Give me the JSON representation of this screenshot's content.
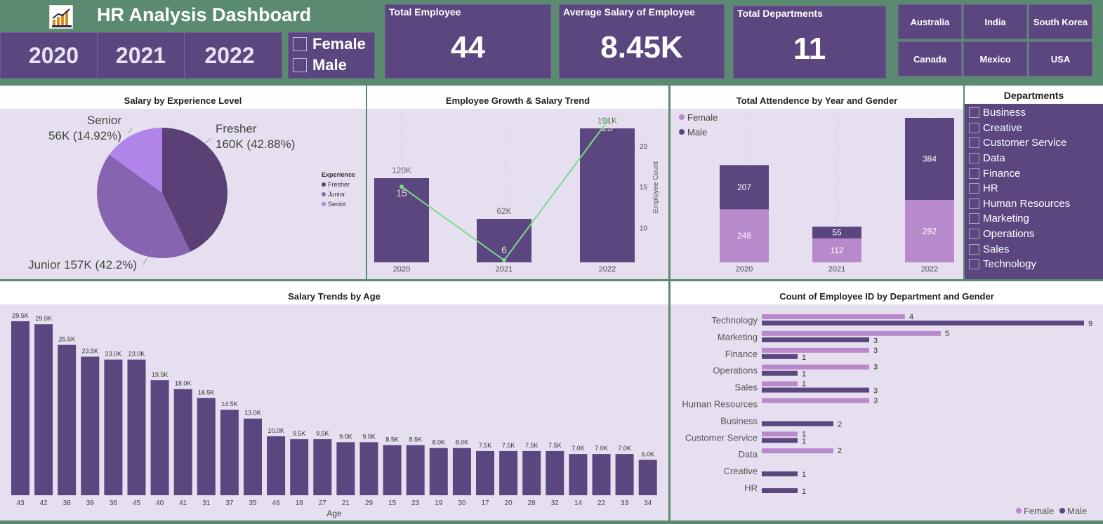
{
  "header": {
    "title": "HR Analysis Dashboard",
    "logo_icon": "company-logo-icon",
    "years": [
      "2020",
      "2021",
      "2022"
    ],
    "genders": [
      "Female",
      "Male"
    ]
  },
  "kpis": {
    "total_employee_label": "Total Employee",
    "total_employee_value": "44",
    "avg_salary_label": "Average Salary of Employee",
    "avg_salary_value": "8.45K",
    "total_departments_label": "Total Departments",
    "total_departments_value": "11"
  },
  "countries": [
    "Australia",
    "India",
    "South Korea",
    "Canada",
    "Mexico",
    "USA"
  ],
  "colors": {
    "header_bg": "#5a8a70",
    "panel": "#5c4680",
    "chart_bg": "#e6dff0",
    "bar_dark": "#5c4680",
    "bar_light": "#b98acb",
    "fresher": "#5a4075",
    "junior": "#8764b0",
    "senior": "#b184ea",
    "line": "#7dd88c"
  },
  "departments_slicer": {
    "title": "Departments",
    "items": [
      "Business",
      "Creative",
      "Customer Service",
      "Data",
      "Finance",
      "HR",
      "Human Resources",
      "Marketing",
      "Operations",
      "Sales",
      "Technology"
    ]
  },
  "charts": {
    "salary_by_experience": {
      "title": "Salary by Experience Level",
      "chart_data": {
        "type": "pie",
        "slices": [
          {
            "name": "Fresher",
            "value": 160,
            "label": "160K (42.88%)",
            "color": "#5a4075"
          },
          {
            "name": "Junior",
            "value": 157,
            "label": "157K (42.2%)",
            "color": "#8764b0"
          },
          {
            "name": "Senior",
            "value": 56,
            "label": "56K (14.92%)",
            "color": "#b184ea"
          }
        ]
      }
    },
    "growth_trend": {
      "title": "Employee Growth & Salary Trend",
      "legend_title": "Experience",
      "legend": [
        "Fresher",
        "Junior",
        "Senior"
      ],
      "y2label": "Employee Count",
      "chart_data": {
        "type": "bar",
        "categories": [
          "2020",
          "2021",
          "2022"
        ],
        "salary_values": [
          120,
          62,
          191
        ],
        "salary_labels": [
          "120K",
          "62K",
          "191K"
        ],
        "employee_count": [
          15,
          6,
          23
        ],
        "y2_ticks": [
          10,
          15,
          20
        ],
        "y2lim": [
          6,
          23
        ]
      }
    },
    "attendance": {
      "title": "Total Attendence by Year and Gender",
      "legend": [
        "Female",
        "Male"
      ],
      "chart_data": {
        "type": "bar",
        "stacked": true,
        "categories": [
          "2020",
          "2021",
          "2022"
        ],
        "series": [
          {
            "name": "Female",
            "values": [
              248,
              112,
              292
            ]
          },
          {
            "name": "Male",
            "values": [
              207,
              55,
              384
            ]
          }
        ]
      }
    },
    "salary_by_age": {
      "title": "Salary Trends by Age",
      "xlabel": "Age",
      "chart_data": {
        "type": "bar",
        "categories": [
          "43",
          "42",
          "38",
          "39",
          "36",
          "45",
          "40",
          "41",
          "31",
          "37",
          "35",
          "46",
          "18",
          "27",
          "21",
          "29",
          "15",
          "23",
          "19",
          "30",
          "17",
          "20",
          "28",
          "32",
          "14",
          "22",
          "33",
          "34"
        ],
        "values": [
          29.5,
          29.0,
          25.5,
          23.5,
          23.0,
          23.0,
          19.5,
          18.0,
          16.5,
          14.5,
          13.0,
          10.0,
          9.5,
          9.5,
          9.0,
          9.0,
          8.5,
          8.5,
          8.0,
          8.0,
          7.5,
          7.5,
          7.5,
          7.5,
          7.0,
          7.0,
          7.0,
          6.0
        ],
        "labels": [
          "29.5K",
          "29.0K",
          "25.5K",
          "23.5K",
          "23.0K",
          "23.0K",
          "19.5K",
          "18.0K",
          "16.5K",
          "14.5K",
          "13.0K",
          "10.0K",
          "9.5K",
          "9.5K",
          "9.0K",
          "9.0K",
          "8.5K",
          "8.5K",
          "8.0K",
          "8.0K",
          "7.5K",
          "7.5K",
          "7.5K",
          "7.5K",
          "7.0K",
          "7.0K",
          "7.0K",
          "6.0K"
        ]
      }
    },
    "dept_gender": {
      "title": "Count of Employee ID by Department and Gender",
      "legend": [
        "Female",
        "Male"
      ],
      "chart_data": {
        "type": "bar",
        "orientation": "horizontal",
        "categories": [
          "Technology",
          "Marketing",
          "Finance",
          "Operations",
          "Sales",
          "Human Resources",
          "Business",
          "Customer Service",
          "Data",
          "Creative",
          "HR"
        ],
        "series": [
          {
            "name": "Female",
            "values": [
              4,
              5,
              3,
              3,
              1,
              3,
              null,
              1,
              2,
              null,
              null
            ]
          },
          {
            "name": "Male",
            "values": [
              9,
              3,
              1,
              1,
              3,
              null,
              2,
              1,
              null,
              1,
              1
            ]
          }
        ]
      }
    }
  }
}
